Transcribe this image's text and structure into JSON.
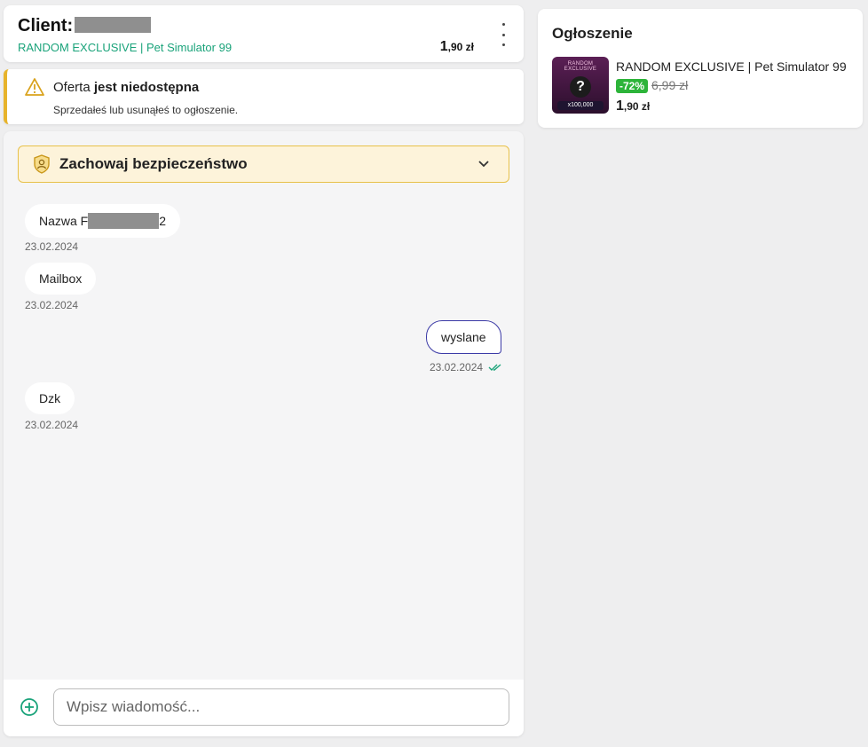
{
  "header": {
    "title_prefix": "Client:",
    "subtitle": "RANDOM EXCLUSIVE | Pet Simulator 99",
    "price_main": "1",
    "price_fraction": ",90 zł"
  },
  "alert": {
    "title_prefix": "Oferta ",
    "title_bold": "jest niedostępna",
    "description": "Sprzedałeś lub usunąłeś to ogłoszenie."
  },
  "safety": {
    "label_bold": "Zachowaj ",
    "label_rest": "bezpieczeństwo"
  },
  "messages": [
    {
      "direction": "in",
      "text_prefix": "Nazwa F",
      "text_suffix": "2",
      "date": "23.02.2024"
    },
    {
      "direction": "in",
      "text": "Mailbox",
      "date": "23.02.2024"
    },
    {
      "direction": "out",
      "text": "wyslane",
      "date": "23.02.2024",
      "status": "double-check-icon"
    },
    {
      "direction": "in",
      "text": "Dzk",
      "date": "23.02.2024"
    }
  ],
  "composer": {
    "placeholder": "Wpisz wiadomość..."
  },
  "listing": {
    "heading": "Ogłoszenie",
    "thumb_label": "RANDOM EXCLUSIVE",
    "thumb_count": "x100,000",
    "name": "RANDOM EXCLUSIVE | Pet Simulator 99",
    "discount": "-72%",
    "old_price": "6,99 zł",
    "price_main": "1",
    "price_fraction": ",90 zł"
  },
  "colors": {
    "accent_green": "#1aa37a",
    "warning": "#e7b32a",
    "outgoing_border": "#3b3aa6",
    "discount_bg": "#2db43a"
  }
}
